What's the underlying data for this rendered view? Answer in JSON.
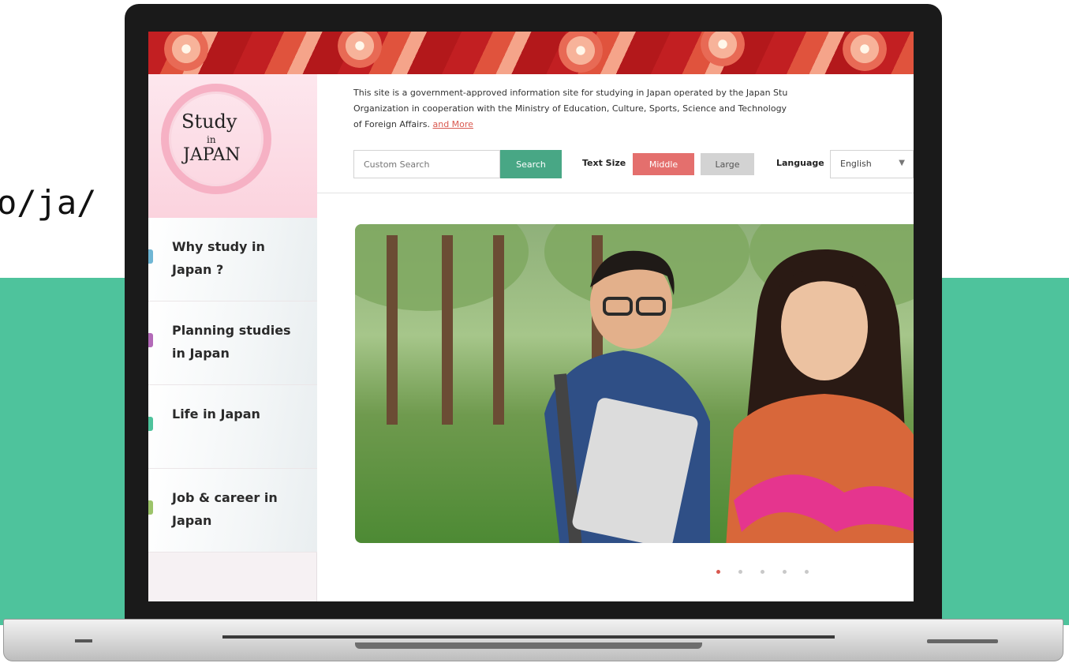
{
  "background": {
    "url_fragment": "o/ja/",
    "accent": "#4ec39c"
  },
  "site": {
    "logo": {
      "line1": "Study",
      "line2": "in",
      "line3": "JAPAN"
    },
    "nav": [
      {
        "label": "Why study in Japan ?"
      },
      {
        "label": "Planning studies in Japan"
      },
      {
        "label": "Life in Japan"
      },
      {
        "label": "Job & career in Japan"
      }
    ],
    "info": {
      "line1": "This site is a government-approved information site for studying in Japan operated by the Japan Stu",
      "line2": "Organization in cooperation with the Ministry of Education, Culture, Sports, Science and Technology",
      "line3": "of Foreign Affairs.",
      "link": "and More"
    },
    "search": {
      "placeholder": "Custom Search",
      "button_label": "Search"
    },
    "text_size": {
      "label": "Text Size",
      "middle": "Middle",
      "large": "Large"
    },
    "language": {
      "label": "Language",
      "selected": "English"
    },
    "carousel": {
      "slide_count": 5,
      "active_index": 0
    }
  }
}
